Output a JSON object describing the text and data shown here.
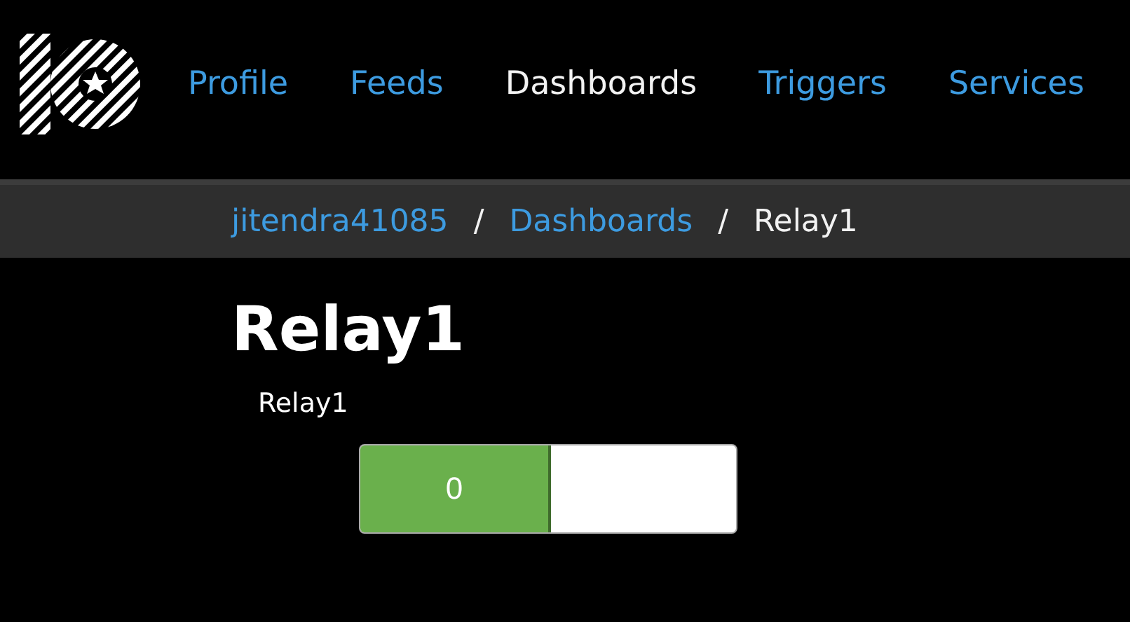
{
  "nav": {
    "items": [
      {
        "label": "Profile",
        "selected": false
      },
      {
        "label": "Feeds",
        "selected": false
      },
      {
        "label": "Dashboards",
        "selected": true
      },
      {
        "label": "Triggers",
        "selected": false
      },
      {
        "label": "Services",
        "selected": false
      }
    ]
  },
  "breadcrumb": {
    "items": [
      "jitendra41085",
      "Dashboards",
      "Relay1"
    ],
    "separators": [
      "/",
      "/"
    ]
  },
  "title": "Relay1",
  "widget": {
    "label": "Relay1",
    "toggle": {
      "value": "0",
      "on": false
    }
  }
}
